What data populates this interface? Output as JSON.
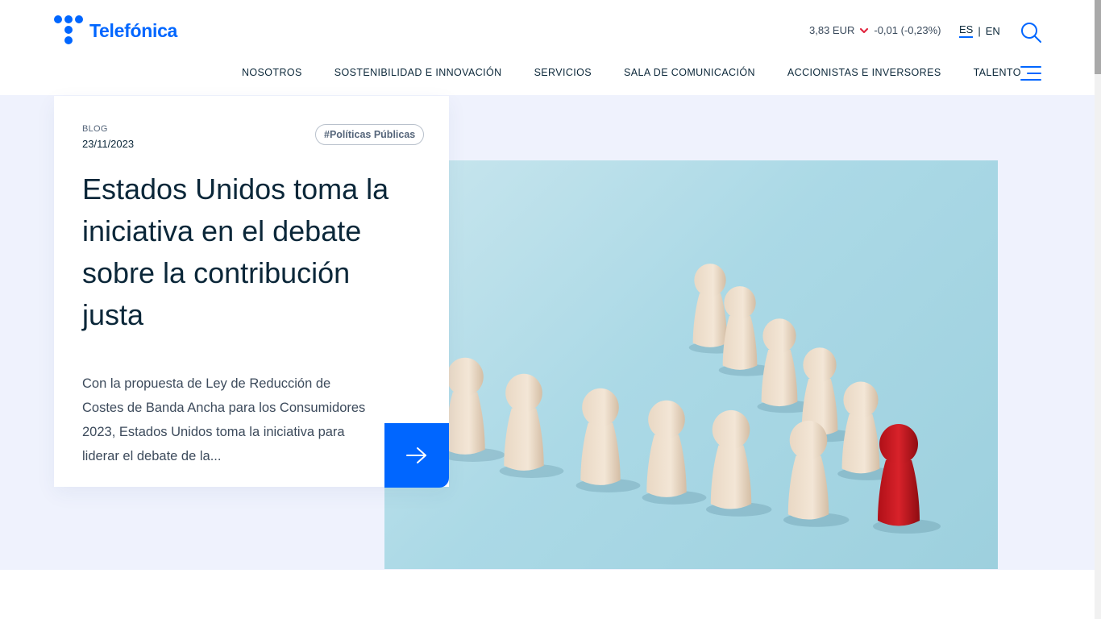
{
  "header": {
    "logo_text": "Telefónica",
    "stock": {
      "price": "3,83 EUR",
      "change": "-0,01 (-0,23%)"
    },
    "languages": {
      "active": "ES",
      "other": "EN"
    }
  },
  "nav": {
    "items": [
      "NOSOTROS",
      "SOSTENIBILIDAD E INNOVACIÓN",
      "SERVICIOS",
      "SALA DE COMUNICACIÓN",
      "ACCIONISTAS E INVERSORES",
      "TALENTO"
    ]
  },
  "article": {
    "category": "BLOG",
    "date": "23/11/2023",
    "tag": "#Políticas Públicas",
    "title": "Estados Unidos toma la iniciativa en el debate sobre la contribución justa",
    "excerpt": "Con la propuesta de Ley de Reducción de Costes de Banda Ancha para los Consumidores 2023, Estados Unidos toma la iniciativa para liderar el debate de la..."
  },
  "colors": {
    "brand": "#0066ff",
    "hero_bg": "#eff2fd",
    "text": "#0b2739",
    "stock_down": "#e0263f",
    "figure_red": "#c8161d"
  },
  "icons": [
    "search-icon",
    "menu-icon",
    "arrow-right-icon",
    "chevron-down-icon"
  ]
}
